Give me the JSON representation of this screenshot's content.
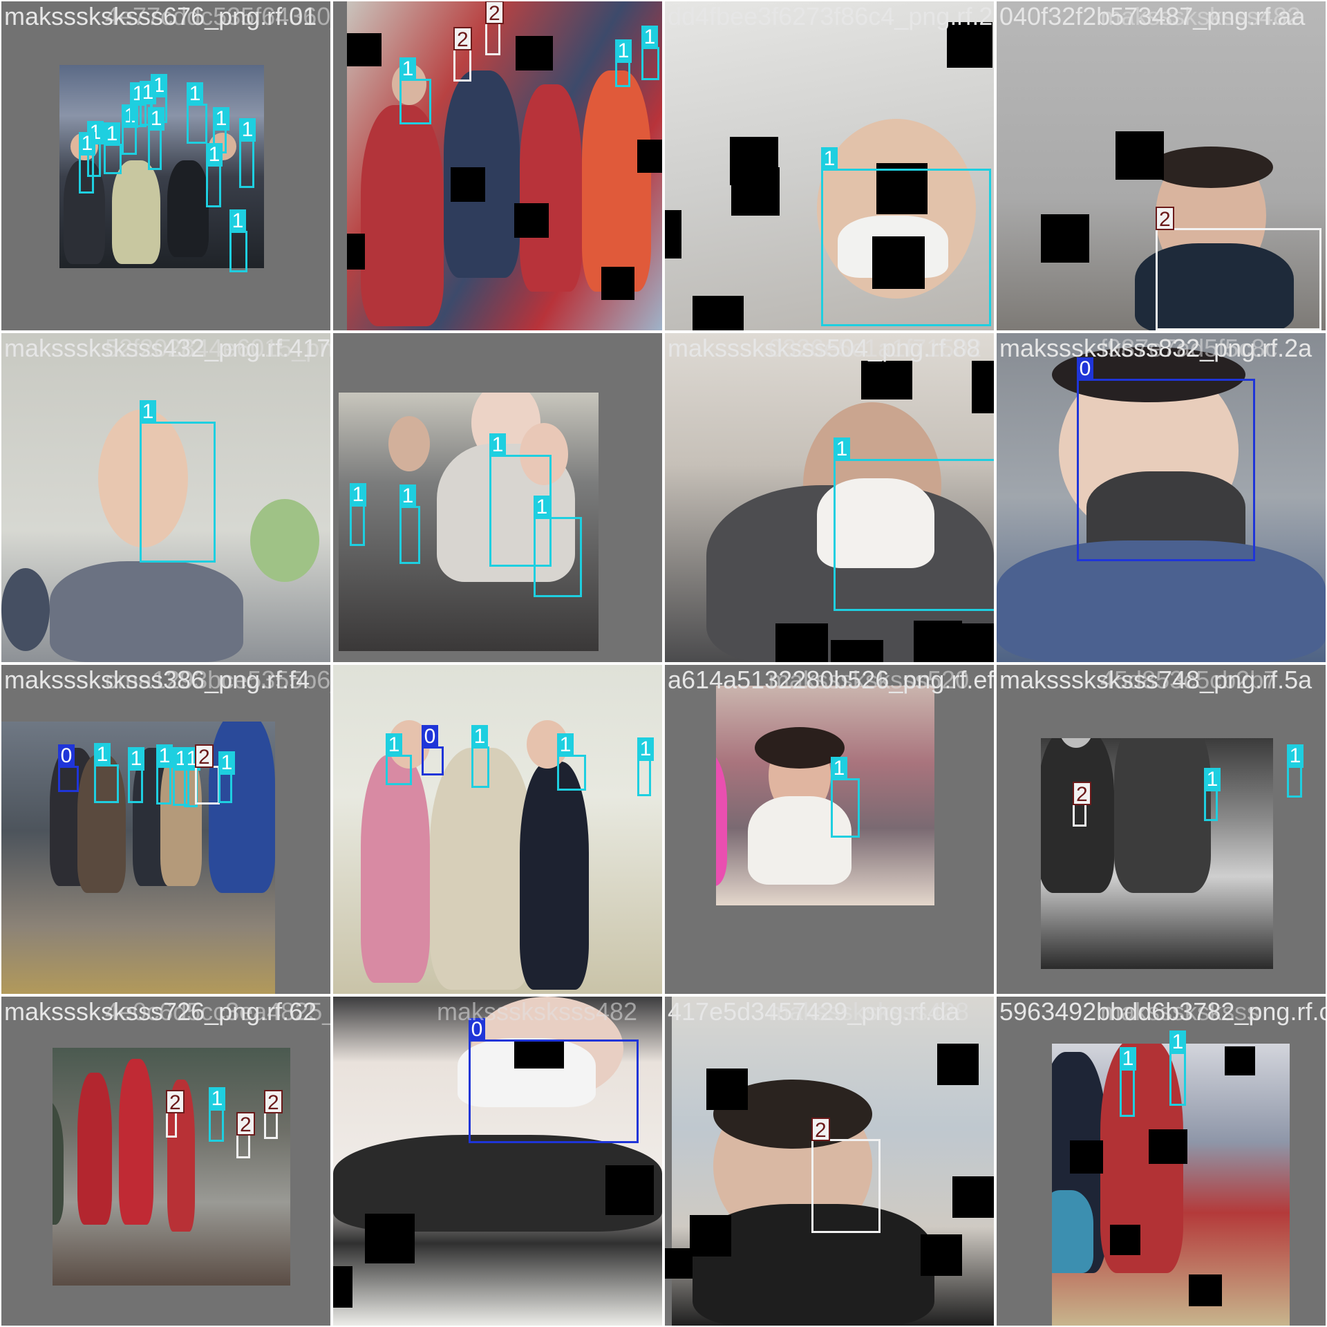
{
  "palette": {
    "class_0": "#1f35d8",
    "class_1": "#1ecfe0",
    "class_2": "#f2f2f2",
    "class_2_text": "#6b1a1a",
    "tile_bg": "#727272",
    "label_text": "#e6e6e6"
  },
  "tiles": [
    {
      "label": "maksssksksss676_png.rf.01",
      "ghost": "4e77cddc535f64360_png.rf.bc",
      "scene": "crowd-umbrellas",
      "boxes": [
        {
          "class": "1"
        },
        {
          "class": "1"
        },
        {
          "class": "1"
        },
        {
          "class": "1"
        },
        {
          "class": "1"
        },
        {
          "class": "1"
        },
        {
          "class": "1"
        },
        {
          "class": "1"
        },
        {
          "class": "1"
        },
        {
          "class": "1"
        },
        {
          "class": "1"
        },
        {
          "class": "1"
        },
        {
          "class": "1"
        }
      ]
    },
    {
      "label": "",
      "ghost": "",
      "scene": "street-queue",
      "boxes": [
        {
          "class": "1"
        },
        {
          "class": "2"
        },
        {
          "class": "2"
        },
        {
          "class": "1"
        },
        {
          "class": "1"
        }
      ]
    },
    {
      "label": "dd4fbee3f6273f86c4_png.rf.27",
      "ghost": "",
      "scene": "selfie-respirator",
      "boxes": [
        {
          "class": "1"
        }
      ]
    },
    {
      "label": "040f32f2b573487_png.rf.aa",
      "ghost": "maksssksksss482",
      "scene": "bearded-man",
      "boxes": [
        {
          "class": "2"
        }
      ]
    },
    {
      "label": "maksssksksss432_png.rf.417",
      "ghost": "52f202844e6015_png.rf.29",
      "scene": "man-covering-face",
      "boxes": [
        {
          "class": "1"
        }
      ]
    },
    {
      "label": "",
      "ghost": "",
      "scene": "subway-car",
      "boxes": [
        {
          "class": "1"
        },
        {
          "class": "1"
        },
        {
          "class": "1"
        },
        {
          "class": "1"
        }
      ]
    },
    {
      "label": "maksssksksss504_png.rf.88",
      "ghost": "0326e5c1a1f71502",
      "scene": "hoodie-mask",
      "boxes": [
        {
          "class": "1"
        }
      ]
    },
    {
      "label": "maksssksksss832_png.rf.2a",
      "ghost": "f987e7ad5f5c8c",
      "scene": "black-mask-man",
      "boxes": [
        {
          "class": "0"
        }
      ]
    },
    {
      "label": "maksssksksss386_png.rf.f4",
      "ghost": "cma1293bce5355b6_png.rf.77",
      "scene": "bus-stop",
      "boxes": [
        {
          "class": "0"
        },
        {
          "class": "1"
        },
        {
          "class": "1"
        },
        {
          "class": "1"
        },
        {
          "class": "1"
        },
        {
          "class": "1"
        },
        {
          "class": "2"
        },
        {
          "class": "1"
        }
      ]
    },
    {
      "label": "",
      "ghost": "",
      "scene": "food-stall",
      "boxes": [
        {
          "class": "1"
        },
        {
          "class": "0"
        },
        {
          "class": "1"
        },
        {
          "class": "1"
        },
        {
          "class": "1"
        },
        {
          "class": "1"
        }
      ]
    },
    {
      "label": "a614a5132280b526_png.rf.ef",
      "ghost": "maksssksksss520",
      "scene": "woman-mall",
      "boxes": [
        {
          "class": "1"
        }
      ]
    },
    {
      "label": "maksssksksss748_png.rf.5a",
      "ghost": "45d853c5cb2b7",
      "scene": "airport-bw",
      "boxes": [
        {
          "class": "2"
        },
        {
          "class": "1"
        },
        {
          "class": "1"
        }
      ]
    },
    {
      "label": "maksssksksss726_png.rf.62",
      "ghost": "4e0c6d5cc3ea4825_png.rf.23",
      "scene": "red-coats-street",
      "boxes": [
        {
          "class": "2"
        },
        {
          "class": "1"
        },
        {
          "class": "2"
        },
        {
          "class": "2"
        }
      ]
    },
    {
      "label": "",
      "ghost": "maksssksksss482",
      "scene": "mask-closeup",
      "boxes": [
        {
          "class": "0"
        }
      ]
    },
    {
      "label": "417e5d3457429_png.rf.da",
      "ghost": "maksssksksss428",
      "scene": "man-window",
      "boxes": [
        {
          "class": "2"
        }
      ]
    },
    {
      "label": "5963492bbdd6b3782_png.rf.c1",
      "ghost": "maksssksksss",
      "scene": "airport-gate",
      "boxes": [
        {
          "class": "1"
        },
        {
          "class": "1"
        }
      ]
    }
  ]
}
